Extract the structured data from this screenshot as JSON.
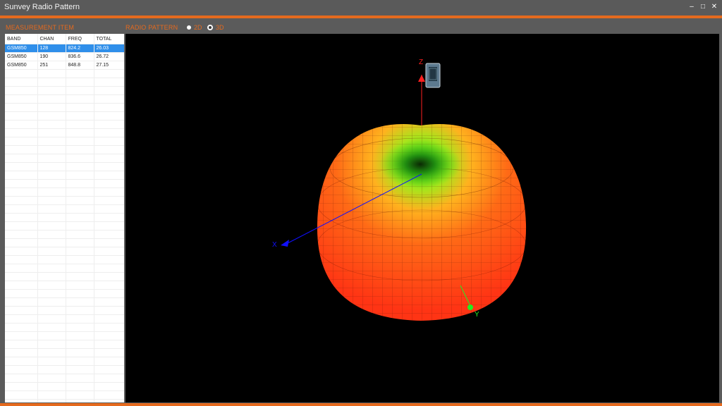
{
  "window": {
    "title": "Sunvey Radio Pattern",
    "minimize_icon": "minimize-icon",
    "restore_icon": "restore-icon",
    "close_icon": "close-icon"
  },
  "measurement": {
    "label": "MEASUREMENT ITEM",
    "columns": [
      "BAND",
      "CHAN",
      "FREQ",
      "TOTAL"
    ],
    "rows": [
      {
        "band": "GSM850",
        "chan": "128",
        "freq": "824.2",
        "total": "26.03",
        "selected": true
      },
      {
        "band": "GSM850",
        "chan": "190",
        "freq": "836.6",
        "total": "26.72",
        "selected": false
      },
      {
        "band": "GSM850",
        "chan": "251",
        "freq": "848.8",
        "total": "27.15",
        "selected": false
      }
    ]
  },
  "radio_pattern": {
    "label": "RADIO PATTERN",
    "options": [
      {
        "label": "2D",
        "selected": false
      },
      {
        "label": "3D",
        "selected": true
      }
    ]
  },
  "viewer": {
    "axes": {
      "x": "X",
      "y": "Y",
      "z": "Z"
    },
    "colors": {
      "x_axis": "#1010ff",
      "y_axis": "#22ee22",
      "z_axis": "#ff2020",
      "pattern_high": "#ff3b1a",
      "pattern_mid": "#ffa21f",
      "pattern_low": "#4fe01a"
    }
  }
}
